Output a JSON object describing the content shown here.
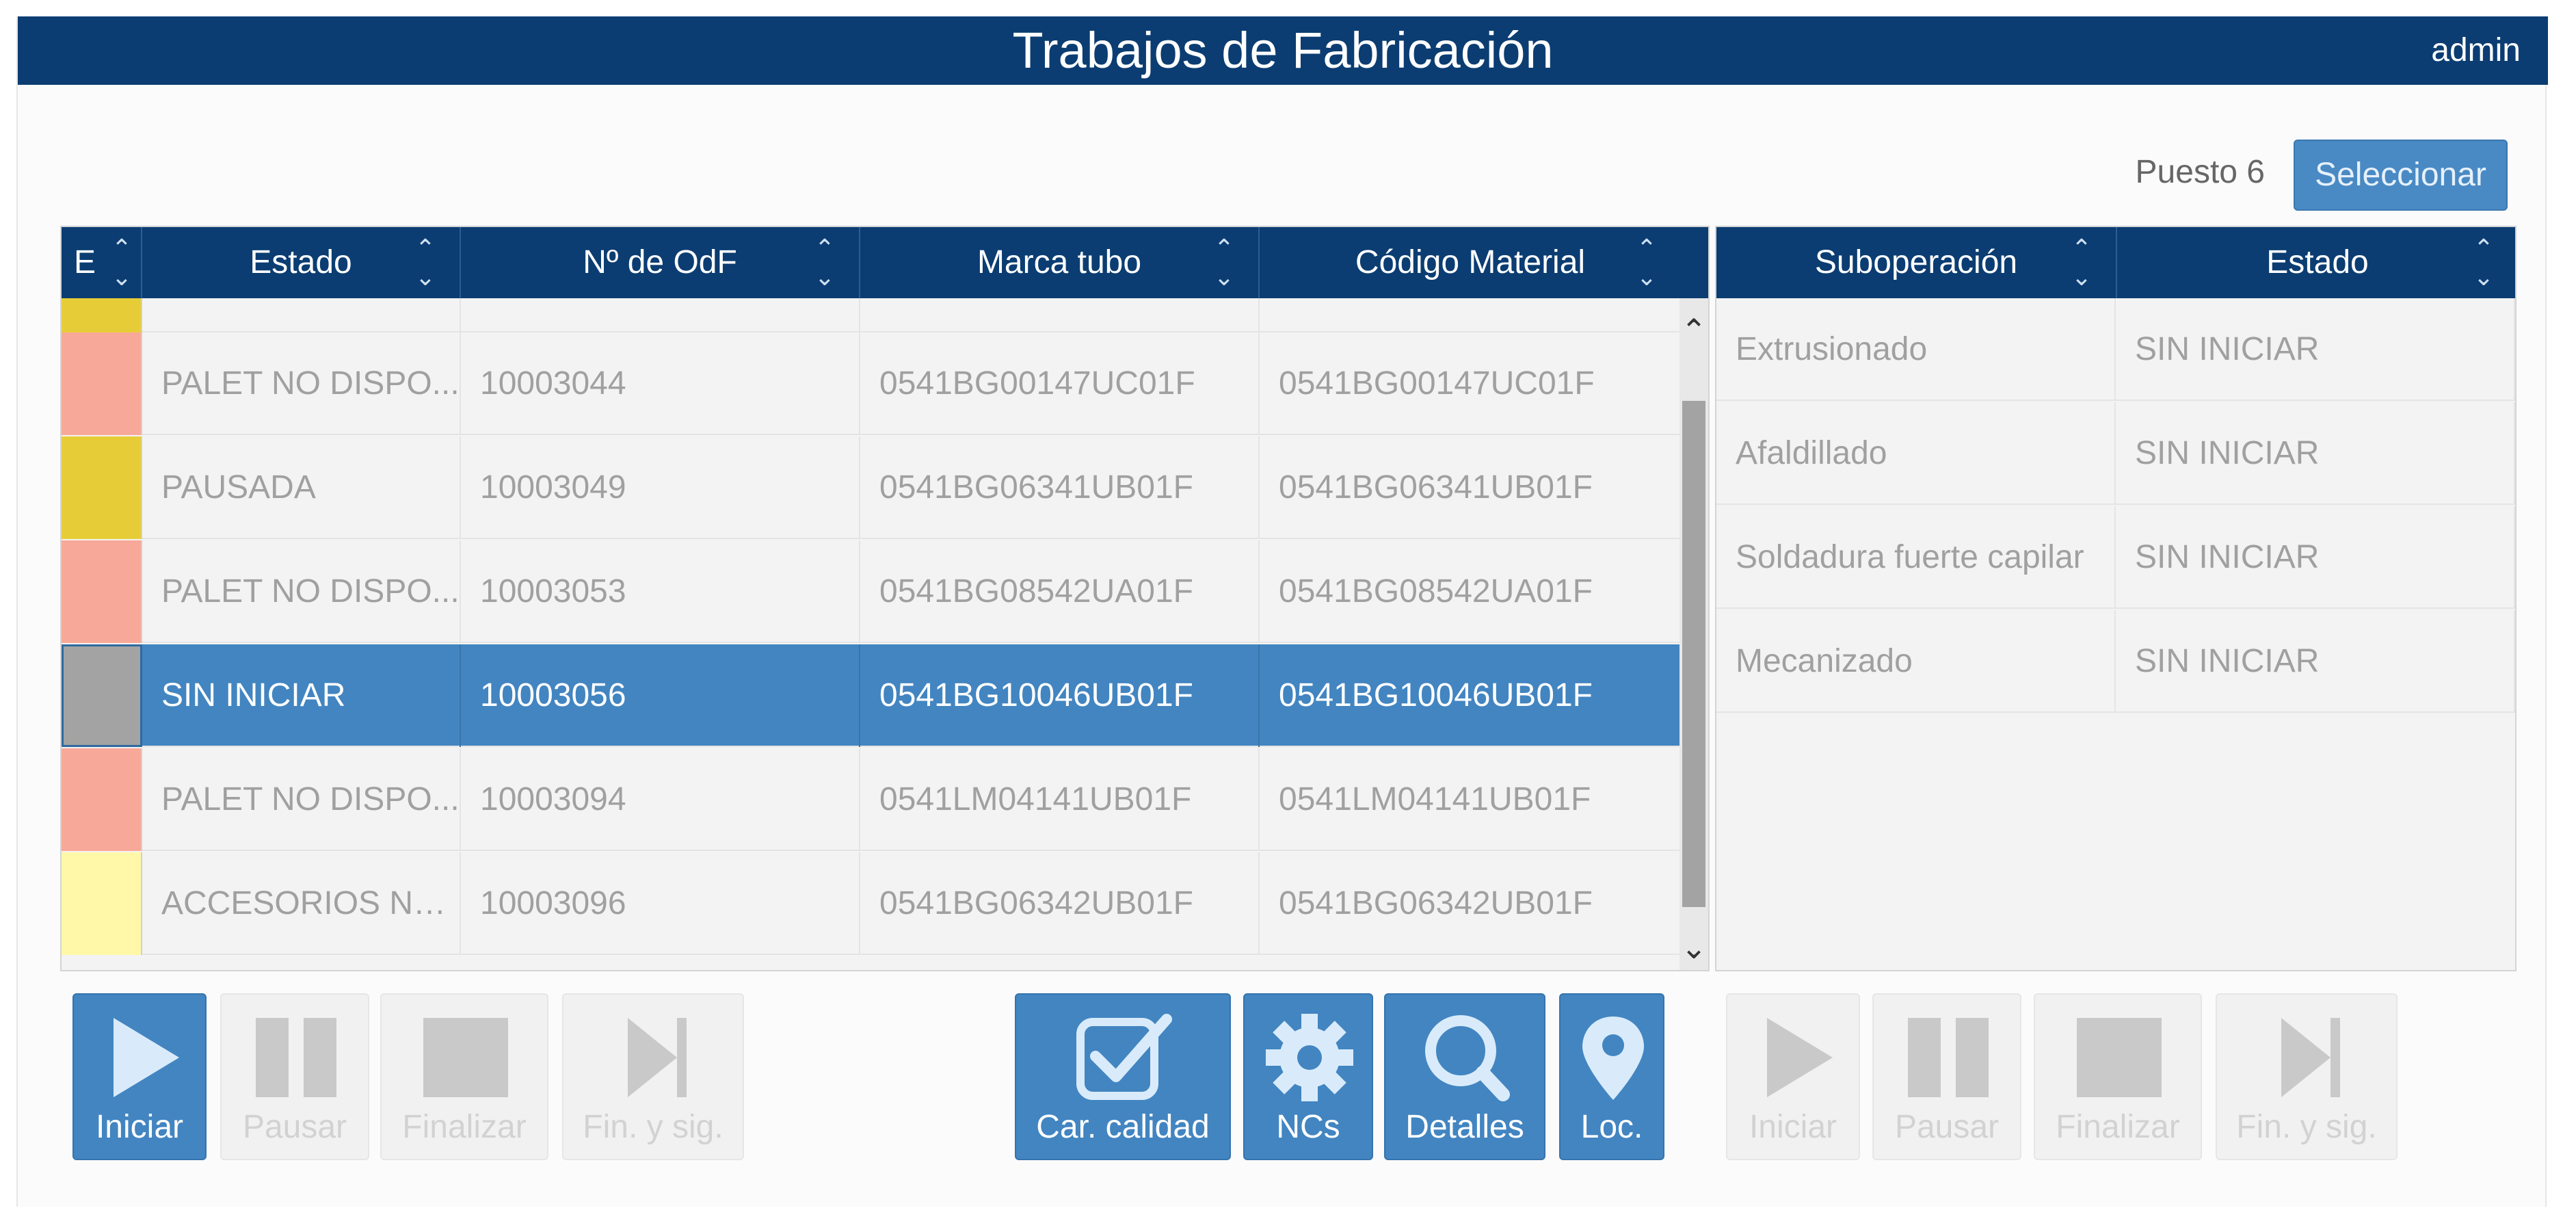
{
  "header": {
    "title": "Trabajos de Fabricación",
    "user": "admin"
  },
  "station": {
    "label": "Puesto 6",
    "select_button": "Seleccionar"
  },
  "jobs_table": {
    "columns": [
      "E",
      "Estado",
      "Nº de OdF",
      "Marca tubo",
      "Código Material"
    ],
    "rows": [
      {
        "color": "#e6cd38",
        "estado": "",
        "odf": "",
        "marca": "",
        "codigo": ""
      },
      {
        "color": "#f8a898",
        "estado": "PALET NO DISPO...",
        "odf": "10003044",
        "marca": "0541BG00147UC01F",
        "codigo": "0541BG00147UC01F"
      },
      {
        "color": "#e6cd38",
        "estado": "PAUSADA",
        "odf": "10003049",
        "marca": "0541BG06341UB01F",
        "codigo": "0541BG06341UB01F"
      },
      {
        "color": "#f8a898",
        "estado": "PALET NO DISPO...",
        "odf": "10003053",
        "marca": "0541BG08542UA01F",
        "codigo": "0541BG08542UA01F"
      },
      {
        "color": "#a3a3a3",
        "estado": "SIN INICIAR",
        "odf": "10003056",
        "marca": "0541BG10046UB01F",
        "codigo": "0541BG10046UB01F",
        "selected": true
      },
      {
        "color": "#f8a898",
        "estado": "PALET NO DISPO...",
        "odf": "10003094",
        "marca": "0541LM04141UB01F",
        "codigo": "0541LM04141UB01F"
      },
      {
        "color": "#fff8a8",
        "estado": "ACCESORIOS NO...",
        "odf": "10003096",
        "marca": "0541BG06342UB01F",
        "codigo": "0541BG06342UB01F"
      }
    ]
  },
  "subops_table": {
    "columns": [
      "Suboperación",
      "Estado"
    ],
    "rows": [
      {
        "name": "Extrusionado",
        "estado": "SIN INICIAR"
      },
      {
        "name": "Afaldillado",
        "estado": "SIN INICIAR"
      },
      {
        "name": "Soldadura fuerte capilar",
        "estado": "SIN INICIAR"
      },
      {
        "name": "Mecanizado",
        "estado": "SIN INICIAR"
      }
    ]
  },
  "left_actions": [
    {
      "label": "Iniciar",
      "icon": "play-icon",
      "enabled": true
    },
    {
      "label": "Pausar",
      "icon": "pause-icon",
      "enabled": false
    },
    {
      "label": "Finalizar",
      "icon": "stop-icon",
      "enabled": false
    },
    {
      "label": "Fin. y sig.",
      "icon": "skip-next-icon",
      "enabled": false
    }
  ],
  "mid_actions": [
    {
      "label": "Car. calidad",
      "icon": "checkbox-icon"
    },
    {
      "label": "NCs",
      "icon": "gear-icon"
    },
    {
      "label": "Detalles",
      "icon": "magnifier-icon"
    },
    {
      "label": "Loc.",
      "icon": "map-pin-icon"
    }
  ],
  "right_actions": [
    {
      "label": "Iniciar",
      "icon": "play-icon",
      "enabled": false
    },
    {
      "label": "Pausar",
      "icon": "pause-icon",
      "enabled": false
    },
    {
      "label": "Finalizar",
      "icon": "stop-icon",
      "enabled": false
    },
    {
      "label": "Fin. y sig.",
      "icon": "skip-next-icon",
      "enabled": false
    }
  ],
  "colors": {
    "header": "#0b3d72",
    "accent": "#4285c1",
    "disabled": "#f1f1f1"
  }
}
